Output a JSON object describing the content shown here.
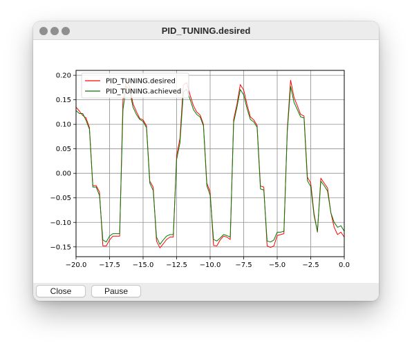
{
  "window": {
    "title": "PID_TUNING.desired"
  },
  "buttons": {
    "close_label": "Close",
    "pause_label": "Pause"
  },
  "chart_data": {
    "type": "line",
    "title": "",
    "xlabel": "",
    "ylabel": "",
    "xlim": [
      -20.0,
      0.0
    ],
    "ylim": [
      -0.17,
      0.21
    ],
    "grid": true,
    "legend_position": "top-left",
    "x_ticks": [
      -20.0,
      -17.5,
      -15.0,
      -12.5,
      -10.0,
      -7.5,
      -5.0,
      -2.5,
      0.0
    ],
    "x_tick_labels": [
      "−20.0",
      "−17.5",
      "−15.0",
      "−12.5",
      "−10.0",
      "−7.5",
      "−5.0",
      "−2.5",
      "0.0"
    ],
    "y_ticks": [
      -0.15,
      -0.1,
      -0.05,
      0.0,
      0.05,
      0.1,
      0.15,
      0.2
    ],
    "y_tick_labels": [
      "−0.15",
      "−0.10",
      "−0.05",
      "0.00",
      "0.05",
      "0.10",
      "0.15",
      "0.20"
    ],
    "series": [
      {
        "name": "PID_TUNING.desired",
        "color": "#ff0000",
        "x": [
          -20.0,
          -19.75,
          -19.5,
          -19.25,
          -19.0,
          -18.75,
          -18.5,
          -18.25,
          -18.0,
          -17.75,
          -17.5,
          -17.25,
          -17.0,
          -16.75,
          -16.5,
          -16.25,
          -16.0,
          -15.75,
          -15.5,
          -15.25,
          -15.0,
          -14.75,
          -14.5,
          -14.25,
          -14.0,
          -13.75,
          -13.5,
          -13.25,
          -13.0,
          -12.75,
          -12.5,
          -12.25,
          -12.0,
          -11.75,
          -11.5,
          -11.25,
          -11.0,
          -10.75,
          -10.5,
          -10.25,
          -10.0,
          -9.75,
          -9.5,
          -9.25,
          -9.0,
          -8.75,
          -8.5,
          -8.25,
          -8.0,
          -7.75,
          -7.5,
          -7.25,
          -7.0,
          -6.75,
          -6.5,
          -6.25,
          -6.0,
          -5.75,
          -5.5,
          -5.25,
          -5.0,
          -4.75,
          -4.5,
          -4.25,
          -4.0,
          -3.75,
          -3.5,
          -3.25,
          -3.0,
          -2.75,
          -2.5,
          -2.25,
          -2.0,
          -1.75,
          -1.5,
          -1.25,
          -1.0,
          -0.75,
          -0.5,
          -0.25,
          0.0
        ],
        "values": [
          0.135,
          0.127,
          0.118,
          0.113,
          0.093,
          -0.025,
          -0.025,
          -0.038,
          -0.148,
          -0.148,
          -0.136,
          -0.128,
          -0.128,
          -0.128,
          0.15,
          0.188,
          0.176,
          0.142,
          0.126,
          0.112,
          0.109,
          0.097,
          -0.016,
          -0.028,
          -0.138,
          -0.152,
          -0.144,
          -0.135,
          -0.13,
          -0.13,
          0.036,
          0.071,
          0.18,
          0.185,
          0.16,
          0.138,
          0.125,
          0.119,
          0.1,
          -0.02,
          -0.038,
          -0.147,
          -0.148,
          -0.136,
          -0.128,
          -0.13,
          -0.135,
          0.11,
          0.141,
          0.181,
          0.17,
          0.14,
          0.115,
          0.109,
          0.098,
          -0.026,
          -0.028,
          -0.148,
          -0.151,
          -0.148,
          -0.127,
          -0.125,
          -0.123,
          0.09,
          0.19,
          0.155,
          0.138,
          0.12,
          0.117,
          -0.008,
          -0.02,
          -0.082,
          -0.12,
          -0.01,
          -0.02,
          -0.03,
          -0.08,
          -0.11,
          -0.125,
          -0.12,
          -0.13
        ]
      },
      {
        "name": "PID_TUNING.achieved",
        "color": "#007a00",
        "x": [
          -20.0,
          -19.75,
          -19.5,
          -19.25,
          -19.0,
          -18.75,
          -18.5,
          -18.25,
          -18.0,
          -17.75,
          -17.5,
          -17.25,
          -17.0,
          -16.75,
          -16.5,
          -16.25,
          -16.0,
          -15.75,
          -15.5,
          -15.25,
          -15.0,
          -14.75,
          -14.5,
          -14.25,
          -14.0,
          -13.75,
          -13.5,
          -13.25,
          -13.0,
          -12.75,
          -12.5,
          -12.25,
          -12.0,
          -11.75,
          -11.5,
          -11.25,
          -11.0,
          -10.75,
          -10.5,
          -10.25,
          -10.0,
          -9.75,
          -9.5,
          -9.25,
          -9.0,
          -8.75,
          -8.5,
          -8.25,
          -8.0,
          -7.75,
          -7.5,
          -7.25,
          -7.0,
          -6.75,
          -6.5,
          -6.25,
          -6.0,
          -5.75,
          -5.5,
          -5.25,
          -5.0,
          -4.75,
          -4.5,
          -4.25,
          -4.0,
          -3.75,
          -3.5,
          -3.25,
          -3.0,
          -2.75,
          -2.5,
          -2.25,
          -2.0,
          -1.75,
          -1.5,
          -1.25,
          -1.0,
          -0.75,
          -0.5,
          -0.25,
          0.0
        ],
        "values": [
          0.128,
          0.122,
          0.122,
          0.108,
          0.09,
          -0.028,
          -0.028,
          -0.045,
          -0.136,
          -0.14,
          -0.128,
          -0.123,
          -0.123,
          -0.123,
          0.13,
          0.178,
          0.168,
          0.135,
          0.12,
          0.11,
          0.106,
          0.093,
          -0.02,
          -0.035,
          -0.13,
          -0.145,
          -0.136,
          -0.128,
          -0.125,
          -0.125,
          0.028,
          0.062,
          0.165,
          0.172,
          0.151,
          0.13,
          0.12,
          0.115,
          0.097,
          -0.025,
          -0.045,
          -0.135,
          -0.138,
          -0.132,
          -0.125,
          -0.127,
          -0.13,
          0.104,
          0.135,
          0.171,
          0.16,
          0.132,
          0.11,
          0.105,
          0.094,
          -0.032,
          -0.034,
          -0.138,
          -0.14,
          -0.136,
          -0.12,
          -0.12,
          -0.118,
          0.085,
          0.177,
          0.145,
          0.13,
          0.115,
          0.113,
          -0.015,
          -0.027,
          -0.086,
          -0.118,
          -0.016,
          -0.025,
          -0.036,
          -0.08,
          -0.1,
          -0.11,
          -0.107,
          -0.118
        ]
      }
    ]
  }
}
